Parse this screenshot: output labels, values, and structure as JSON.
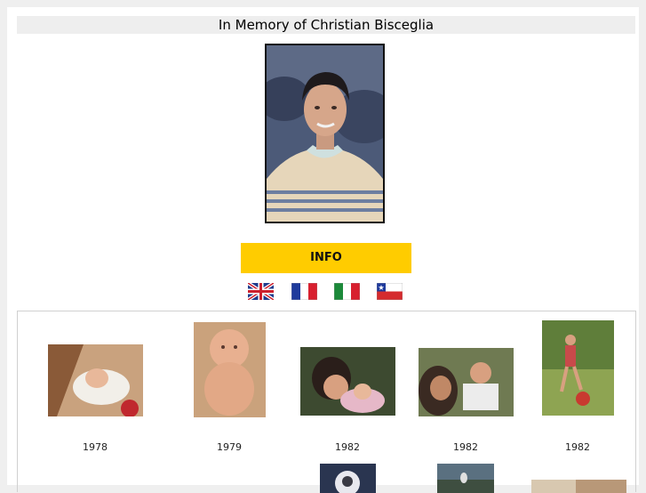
{
  "page": {
    "title": "In Memory of Christian Bisceglia"
  },
  "info_button": {
    "label": "INFO"
  },
  "languages": [
    "English",
    "French",
    "Italian",
    "Chilean"
  ],
  "gallery": {
    "items": [
      {
        "year": "1978"
      },
      {
        "year": "1979"
      },
      {
        "year": "1982"
      },
      {
        "year": "1982"
      },
      {
        "year": "1982"
      }
    ]
  },
  "colors": {
    "accent": "#ffcc00",
    "title_bar": "#eeeeee",
    "background": "#efefef"
  }
}
